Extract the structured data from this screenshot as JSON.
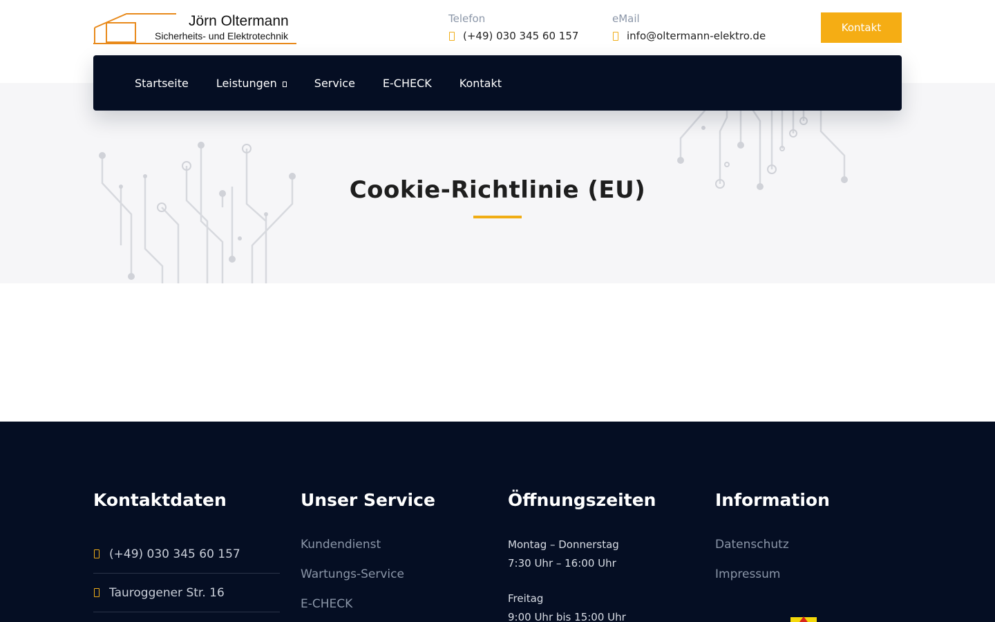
{
  "brand": {
    "name": "Jörn Oltermann",
    "subtitle": "Sicherheits- und Elektrotechnik",
    "accent": "#f5ad14",
    "dark": "#050e23"
  },
  "header": {
    "phone_label": "Telefon",
    "phone_value": "(+49) 030 345 60 157",
    "email_label": "eMail",
    "email_value": "info@oltermann-elektro.de",
    "cta_label": "Kontakt"
  },
  "nav": {
    "items": [
      {
        "label": "Startseite"
      },
      {
        "label": "Leistungen"
      },
      {
        "label": "Service"
      },
      {
        "label": "E-CHECK"
      },
      {
        "label": "Kontakt"
      }
    ]
  },
  "hero": {
    "title": "Cookie-Richtlinie (EU)"
  },
  "footer": {
    "contact": {
      "heading": "Kontaktdaten",
      "phone": "(+49) 030 345 60 157",
      "address": "Tauroggener Str. 16"
    },
    "service": {
      "heading": "Unser Service",
      "links": [
        "Kundendienst",
        "Wartungs-Service",
        "E-CHECK"
      ]
    },
    "hours": {
      "heading": "Öffnungszeiten",
      "line1": "Montag – Donnerstag",
      "line2": "7:30 Uhr – 16:00 Uhr",
      "line3": "Freitag",
      "line4": "9:00 Uhr bis 15:00 Uhr"
    },
    "info": {
      "heading": "Information",
      "links": [
        "Datenschutz",
        "Impressum"
      ]
    }
  }
}
